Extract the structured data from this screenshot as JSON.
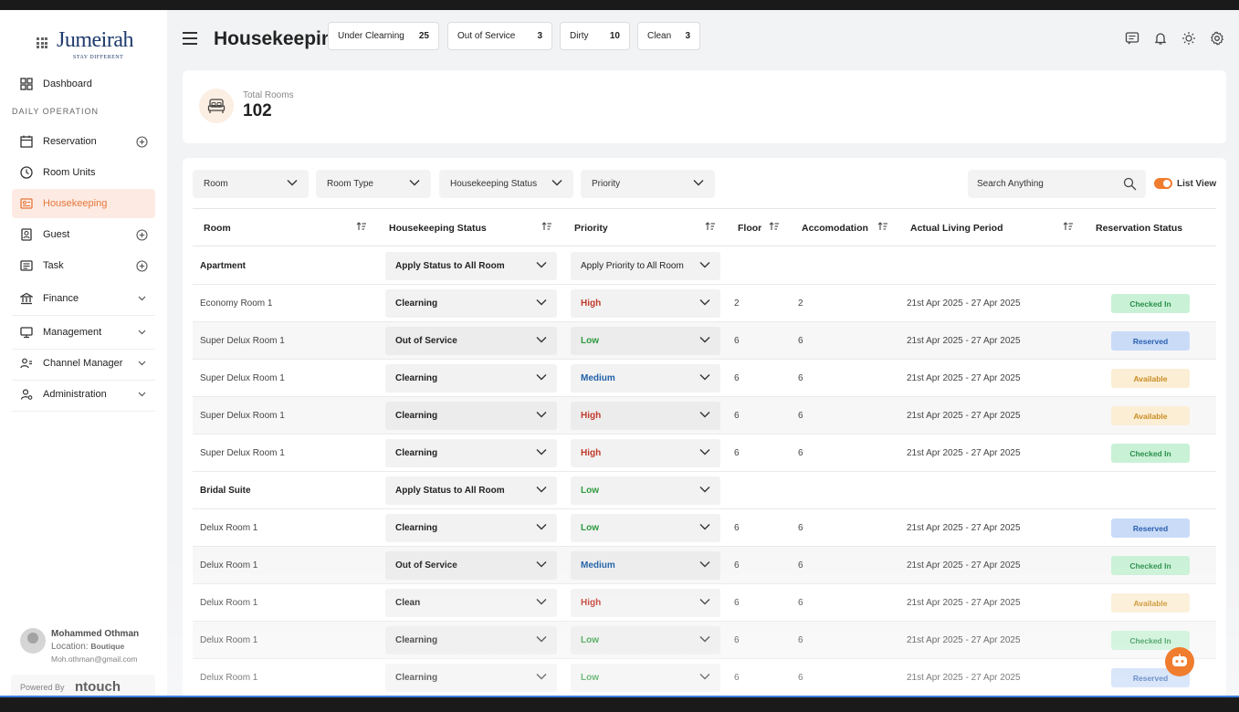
{
  "app": {
    "brand": "Jumeirah",
    "tagline": "STAY DIFFERENT",
    "page_title": "Housekeeping"
  },
  "sidebar": {
    "section_label": "DAILY OPERATION",
    "items": [
      {
        "label": "Dashboard",
        "icon": "dashboard-icon",
        "trail": ""
      },
      {
        "label": "Reservation",
        "icon": "calendar-icon",
        "trail": "plus"
      },
      {
        "label": "Room Units",
        "icon": "clock-icon",
        "trail": ""
      },
      {
        "label": "Housekeeping",
        "icon": "housekeeping-icon",
        "trail": ""
      },
      {
        "label": "Guest",
        "icon": "guest-icon",
        "trail": "plus"
      },
      {
        "label": "Task",
        "icon": "task-icon",
        "trail": "plus"
      },
      {
        "label": "Finance",
        "icon": "bank-icon",
        "trail": "chevron"
      },
      {
        "label": "Management",
        "icon": "monitor-icon",
        "trail": "chevron"
      },
      {
        "label": "Channel Manager",
        "icon": "users-icon",
        "trail": "chevron"
      },
      {
        "label": "Administration",
        "icon": "admin-icon",
        "trail": "chevron"
      }
    ],
    "user": {
      "name": "Mohammed Othman",
      "location_label": "Location:",
      "location": "Boutique",
      "email": "Moh.othman@gmail.com"
    },
    "powered_by": "Powered By",
    "powered_brand": "ntouch"
  },
  "summary": {
    "total_label": "Total Rooms",
    "total_value": "102",
    "stats": [
      {
        "label": "Under Clearning",
        "value": "25"
      },
      {
        "label": "Out of Service",
        "value": "3"
      },
      {
        "label": "Dirty",
        "value": "10"
      },
      {
        "label": "Clean",
        "value": "3"
      }
    ]
  },
  "filters": {
    "room": "Room",
    "room_type": "Room Type",
    "housekeeping_status": "Housekeeping Status",
    "priority": "Priority",
    "search_placeholder": "Search Anything",
    "view_toggle": "List View"
  },
  "table": {
    "headers": [
      "Room",
      "Housekeeping Status",
      "Priority",
      "Floor",
      "Accomodation",
      "Actual Living Period",
      "Reservation Status"
    ],
    "rows": [
      {
        "type": "group",
        "name": "Apartment",
        "status": "Apply Status to All Room",
        "priority": "Apply Priority to All Room"
      },
      {
        "type": "room",
        "name": "Economy Room 1",
        "status": "Clearning",
        "priority": "High",
        "floor": "2",
        "accom": "2",
        "period": "21st Apr 2025 - 27 Apr 2025",
        "reservation": "Checked In"
      },
      {
        "type": "room",
        "name": "Super Delux Room 1",
        "status": "Out of Service",
        "priority": "Low",
        "floor": "6",
        "accom": "6",
        "period": "21st Apr 2025 - 27 Apr 2025",
        "reservation": "Reserved"
      },
      {
        "type": "room",
        "name": "Super Delux Room 1",
        "status": "Clearning",
        "priority": "Medium",
        "floor": "6",
        "accom": "6",
        "period": "21st Apr 2025 - 27 Apr 2025",
        "reservation": "Available"
      },
      {
        "type": "room",
        "name": "Super Delux Room 1",
        "status": "Clearning",
        "priority": "High",
        "floor": "6",
        "accom": "6",
        "period": "21st Apr 2025 - 27 Apr 2025",
        "reservation": "Available"
      },
      {
        "type": "room",
        "name": "Super Delux Room 1",
        "status": "Clearning",
        "priority": "High",
        "floor": "6",
        "accom": "6",
        "period": "21st Apr 2025 - 27 Apr 2025",
        "reservation": "Checked In"
      },
      {
        "type": "group",
        "name": "Bridal Suite",
        "status": "Apply Status to All Room",
        "priority": "Low"
      },
      {
        "type": "room",
        "name": "Delux Room 1",
        "status": "Clearning",
        "priority": "Low",
        "floor": "6",
        "accom": "6",
        "period": "21st Apr 2025 - 27 Apr 2025",
        "reservation": "Reserved"
      },
      {
        "type": "room",
        "name": "Delux Room 1",
        "status": "Out of Service",
        "priority": "Medium",
        "floor": "6",
        "accom": "6",
        "period": "21st Apr 2025 - 27 Apr 2025",
        "reservation": "Checked In"
      },
      {
        "type": "room",
        "name": "Delux Room 1",
        "status": "Clean",
        "priority": "High",
        "floor": "6",
        "accom": "6",
        "period": "21st Apr 2025 - 27 Apr 2025",
        "reservation": "Available"
      },
      {
        "type": "room",
        "name": "Delux Room 1",
        "status": "Clearning",
        "priority": "Low",
        "floor": "6",
        "accom": "6",
        "period": "21st Apr 2025 - 27 Apr 2025",
        "reservation": "Checked In"
      },
      {
        "type": "room",
        "name": "Delux Room 1",
        "status": "Clearning",
        "priority": "Low",
        "floor": "6",
        "accom": "6",
        "period": "21st Apr 2025 - 27 Apr 2025",
        "reservation": "Reserved"
      }
    ]
  },
  "colors": {
    "accent": "#f07c2e",
    "brand": "#1f3a6d",
    "high": "#c0392b",
    "low": "#2e9b3f",
    "medium": "#1f5fa8"
  }
}
